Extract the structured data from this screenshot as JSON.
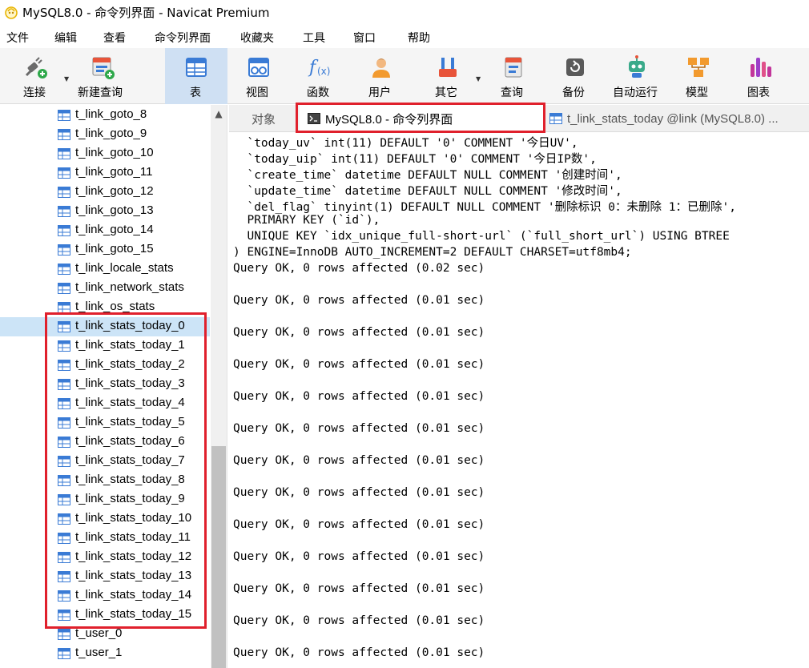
{
  "window": {
    "title": "MySQL8.0 - 命令列界面 - Navicat Premium"
  },
  "menu": [
    "文件",
    "编辑",
    "查看",
    "命令列界面",
    "收藏夹",
    "工具",
    "窗口",
    "帮助"
  ],
  "toolbar": {
    "buttons": [
      {
        "label": "连接",
        "icon": "plug-connect-icon"
      },
      {
        "label": "新建查询",
        "icon": "new-query-icon"
      },
      {
        "label": "表",
        "icon": "table-icon"
      },
      {
        "label": "视图",
        "icon": "view-icon"
      },
      {
        "label": "函数",
        "icon": "function-icon"
      },
      {
        "label": "用户",
        "icon": "user-icon"
      },
      {
        "label": "其它",
        "icon": "tools-icon"
      },
      {
        "label": "查询",
        "icon": "query-icon"
      },
      {
        "label": "备份",
        "icon": "backup-icon"
      },
      {
        "label": "自动运行",
        "icon": "robot-icon"
      },
      {
        "label": "模型",
        "icon": "model-icon"
      },
      {
        "label": "图表",
        "icon": "chart-icon"
      }
    ],
    "active": "表"
  },
  "tree": {
    "items": [
      "t_link_goto_8",
      "t_link_goto_9",
      "t_link_goto_10",
      "t_link_goto_11",
      "t_link_goto_12",
      "t_link_goto_13",
      "t_link_goto_14",
      "t_link_goto_15",
      "t_link_locale_stats",
      "t_link_network_stats",
      "t_link_os_stats",
      "t_link_stats_today_0",
      "t_link_stats_today_1",
      "t_link_stats_today_2",
      "t_link_stats_today_3",
      "t_link_stats_today_4",
      "t_link_stats_today_5",
      "t_link_stats_today_6",
      "t_link_stats_today_7",
      "t_link_stats_today_8",
      "t_link_stats_today_9",
      "t_link_stats_today_10",
      "t_link_stats_today_11",
      "t_link_stats_today_12",
      "t_link_stats_today_13",
      "t_link_stats_today_14",
      "t_link_stats_today_15",
      "t_user_0",
      "t_user_1"
    ],
    "selected": "t_link_stats_today_0"
  },
  "tabs": {
    "objects": "对象",
    "console": "MySQL8.0 - 命令列界面",
    "table": "t_link_stats_today @link (MySQL8.0) ..."
  },
  "console": {
    "lines": [
      "  `today_uv` int(11) DEFAULT '0' COMMENT '今日UV',",
      "  `today_uip` int(11) DEFAULT '0' COMMENT '今日IP数',",
      "  `create_time` datetime DEFAULT NULL COMMENT '创建时间',",
      "  `update_time` datetime DEFAULT NULL COMMENT '修改时间',",
      "  `del_flag` tinyint(1) DEFAULT NULL COMMENT '删除标识 0：未删除 1：已删除',",
      "  PRIMARY KEY (`id`),",
      "  UNIQUE KEY `idx_unique_full-short-url` (`full_short_url`) USING BTREE",
      ") ENGINE=InnoDB AUTO_INCREMENT=2 DEFAULT CHARSET=utf8mb4;",
      "Query OK, 0 rows affected (0.02 sec)",
      "",
      "Query OK, 0 rows affected (0.01 sec)",
      "",
      "Query OK, 0 rows affected (0.01 sec)",
      "",
      "Query OK, 0 rows affected (0.01 sec)",
      "",
      "Query OK, 0 rows affected (0.01 sec)",
      "",
      "Query OK, 0 rows affected (0.01 sec)",
      "",
      "Query OK, 0 rows affected (0.01 sec)",
      "",
      "Query OK, 0 rows affected (0.01 sec)",
      "",
      "Query OK, 0 rows affected (0.01 sec)",
      "",
      "Query OK, 0 rows affected (0.01 sec)",
      "",
      "Query OK, 0 rows affected (0.01 sec)",
      "",
      "Query OK, 0 rows affected (0.01 sec)",
      "",
      "Query OK, 0 rows affected (0.01 sec)"
    ]
  },
  "colors": {
    "highlight": "#e0202c",
    "selected_row": "#cce4f7",
    "active_toolbar": "#cfe0f3"
  }
}
